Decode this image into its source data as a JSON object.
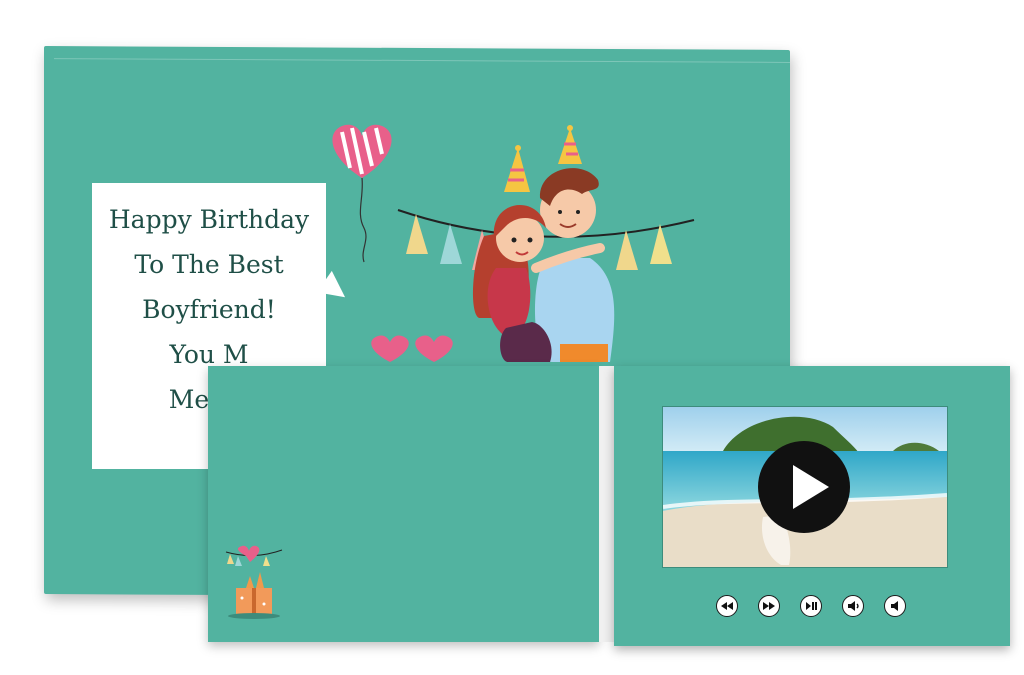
{
  "card": {
    "message_lines": [
      "Happy Birthday",
      "To The Best",
      "Boyfriend!",
      "You M",
      "Me So"
    ]
  },
  "video": {
    "controls": [
      {
        "name": "rewind-icon"
      },
      {
        "name": "fast-forward-icon"
      },
      {
        "name": "play-pause-icon"
      },
      {
        "name": "volume-down-icon"
      },
      {
        "name": "volume-up-icon"
      }
    ]
  },
  "colors": {
    "card_teal": "#52b3a0",
    "text": "#1f4f47",
    "accent_pink": "#e8608a"
  }
}
